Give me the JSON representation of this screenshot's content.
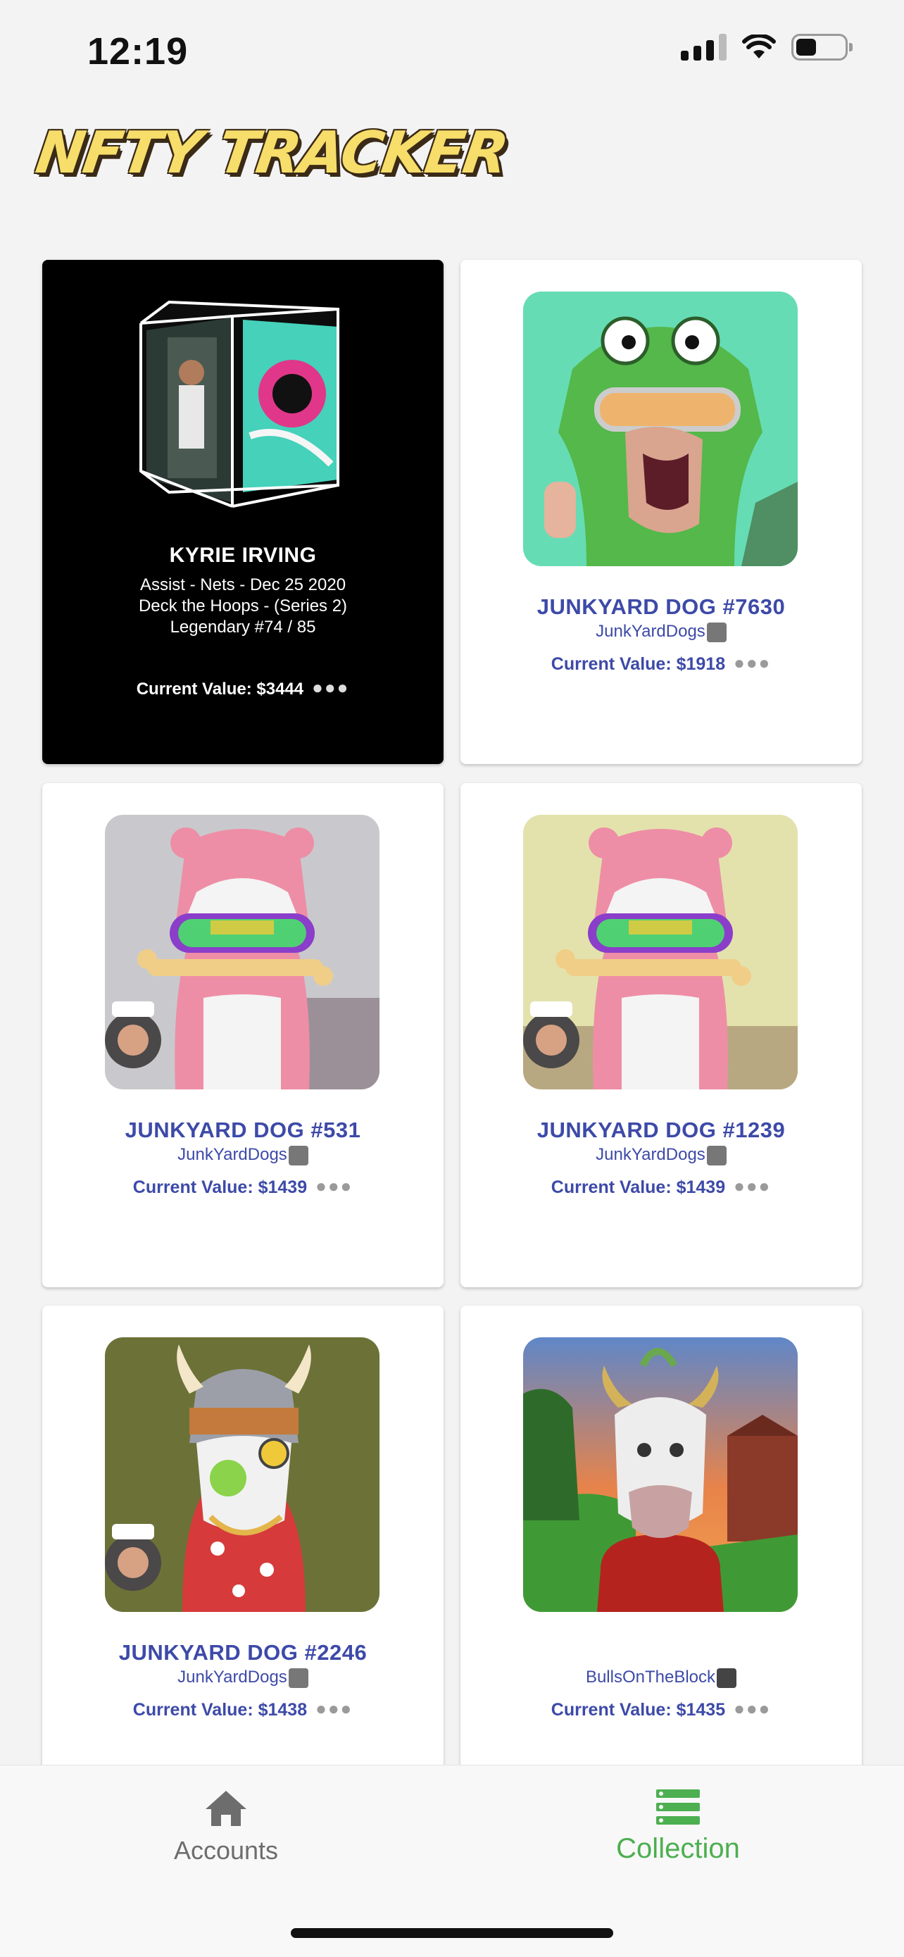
{
  "status_bar": {
    "time": "12:19",
    "battery_level": 0.45,
    "signal_bars": 3
  },
  "app": {
    "logo_text": "NFTY TRACKER"
  },
  "cards": [
    {
      "title": "KYRIE IRVING",
      "lines": [
        "Assist - Nets - Dec 25 2020",
        "Deck the Hoops - (Series 2)",
        "Legendary #74 / 85"
      ],
      "value": "Current Value: $3444",
      "theme": "dark"
    },
    {
      "title": "JUNKYARD DOG #7630",
      "collection": "JunkYardDogs",
      "value": "Current Value: $1918",
      "bg": "#66dcb4"
    },
    {
      "title": "JUNKYARD DOG #531",
      "collection": "JunkYardDogs",
      "value": "Current Value: $1439",
      "bg": "#c9c9cd"
    },
    {
      "title": "JUNKYARD DOG #1239",
      "collection": "JunkYardDogs",
      "value": "Current Value: $1439",
      "bg": "#e3e2ad"
    },
    {
      "title": "JUNKYARD DOG #2246",
      "collection": "JunkYardDogs",
      "value": "Current Value: $1438",
      "bg": "#6c7137"
    },
    {
      "title": "",
      "collection": "BullsOnTheBlock",
      "value": "Current Value: $1435",
      "bg": "#6e8fc9"
    }
  ],
  "tabs": {
    "accounts": {
      "label": "Accounts",
      "icon": "home-icon"
    },
    "collection": {
      "label": "Collection",
      "icon": "collection-list-icon",
      "active": true
    }
  },
  "colors": {
    "accent": "#3d4aa8",
    "active_tab": "#4caf50",
    "background": "#f3f3f4"
  }
}
